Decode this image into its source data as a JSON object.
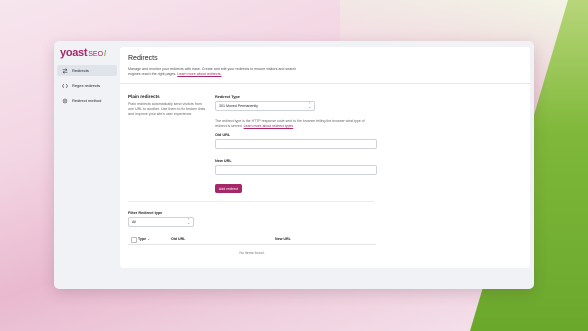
{
  "colors": {
    "brand": "#a4286a",
    "accent_green": "#77b227"
  },
  "logo": {
    "text": "yoast",
    "suffix": "SEO",
    "slash": "/"
  },
  "sidebar": {
    "items": [
      {
        "label": "Redirects",
        "icon": "redirect-arrows-icon",
        "active": true
      },
      {
        "label": "Regex redirects",
        "icon": "code-icon",
        "active": false
      },
      {
        "label": "Redirect method",
        "icon": "gear-icon",
        "active": false
      }
    ]
  },
  "page": {
    "title": "Redirects",
    "description": "Manage and monitor your redirects with ease. Create and edit your redirects to ensure visitors and search engines reach the right pages.",
    "description_link": "Learn more about redirects."
  },
  "plain": {
    "title": "Plain redirects",
    "description": "Plain redirects automatically send visitors from one URL to another. Use them to fix broken links and improve your site's user experience."
  },
  "form": {
    "redirect_type_label": "Redirect Type",
    "redirect_type_value": "301 Moved Permanently",
    "help_text": "The redirect type is the HTTP response code sent to the browser telling the browser what type of redirect is served.",
    "help_link": "Learn more about redirect types",
    "old_url_label": "Old URL",
    "new_url_label": "New URL",
    "add_button": "Add redirect"
  },
  "filter": {
    "label": "Filter Redirect type",
    "value": "All"
  },
  "table": {
    "columns": [
      "Type",
      "Old URL",
      "New URL"
    ],
    "empty_text": "No items found."
  }
}
